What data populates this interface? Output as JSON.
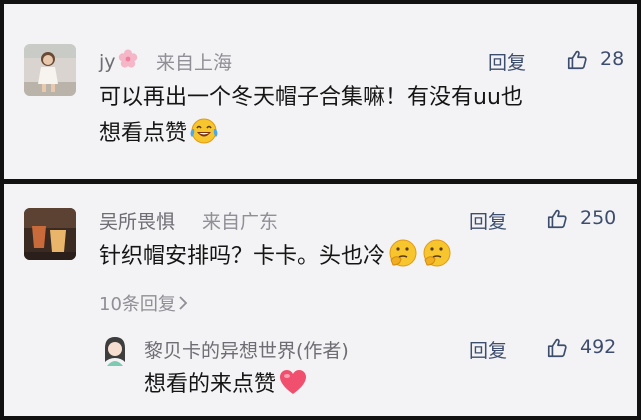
{
  "comments": [
    {
      "user": "jy",
      "name_decoration_icon": "cherry-blossom-icon",
      "location": "来自上海",
      "reply_label": "回复",
      "likes": "28",
      "text_line1": "可以再出一个冬天帽子合集嘛！有没有uu也",
      "text_line2": "想看点赞",
      "emoji": "laughing-tears-emoji"
    },
    {
      "user": "吴所畏惧",
      "location": "来自广东",
      "reply_label": "回复",
      "likes": "250",
      "text": "针织帽安排吗？卡卡。头也冷",
      "emoji": "thinking-face-emoji",
      "more_replies": "10条回复",
      "more_icon": "chevron-right-icon",
      "sub_reply": {
        "user": "黎贝卡的异想世界(作者)",
        "reply_label": "回复",
        "likes": "492",
        "text": "想看的来点赞",
        "emoji": "heart-emoji"
      }
    }
  ],
  "colors": {
    "background": "#111111",
    "card": "#f3f3f5",
    "name": "#6d6d73",
    "action": "#3d4d6e",
    "text": "#151515"
  }
}
